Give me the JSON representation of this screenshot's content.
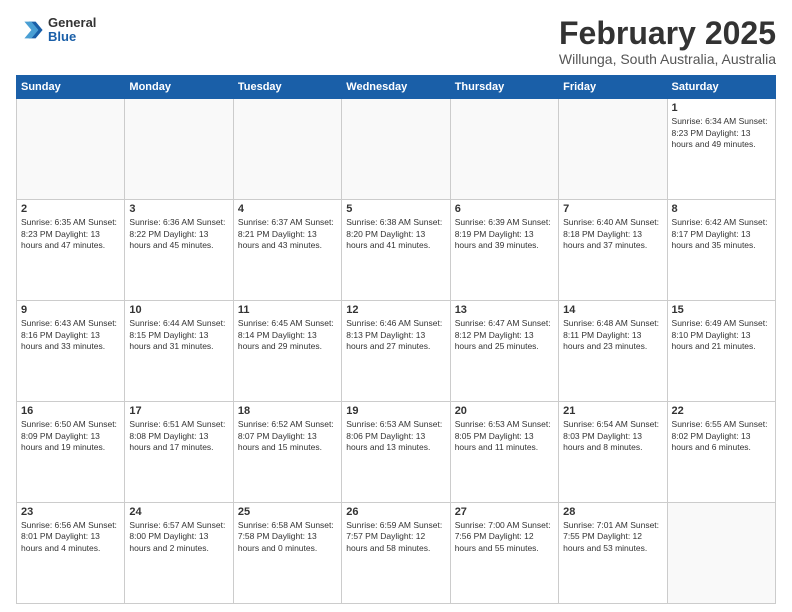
{
  "logo": {
    "general": "General",
    "blue": "Blue"
  },
  "header": {
    "title": "February 2025",
    "subtitle": "Willunga, South Australia, Australia"
  },
  "weekdays": [
    "Sunday",
    "Monday",
    "Tuesday",
    "Wednesday",
    "Thursday",
    "Friday",
    "Saturday"
  ],
  "weeks": [
    [
      {
        "day": "",
        "info": ""
      },
      {
        "day": "",
        "info": ""
      },
      {
        "day": "",
        "info": ""
      },
      {
        "day": "",
        "info": ""
      },
      {
        "day": "",
        "info": ""
      },
      {
        "day": "",
        "info": ""
      },
      {
        "day": "1",
        "info": "Sunrise: 6:34 AM\nSunset: 8:23 PM\nDaylight: 13 hours\nand 49 minutes."
      }
    ],
    [
      {
        "day": "2",
        "info": "Sunrise: 6:35 AM\nSunset: 8:23 PM\nDaylight: 13 hours\nand 47 minutes."
      },
      {
        "day": "3",
        "info": "Sunrise: 6:36 AM\nSunset: 8:22 PM\nDaylight: 13 hours\nand 45 minutes."
      },
      {
        "day": "4",
        "info": "Sunrise: 6:37 AM\nSunset: 8:21 PM\nDaylight: 13 hours\nand 43 minutes."
      },
      {
        "day": "5",
        "info": "Sunrise: 6:38 AM\nSunset: 8:20 PM\nDaylight: 13 hours\nand 41 minutes."
      },
      {
        "day": "6",
        "info": "Sunrise: 6:39 AM\nSunset: 8:19 PM\nDaylight: 13 hours\nand 39 minutes."
      },
      {
        "day": "7",
        "info": "Sunrise: 6:40 AM\nSunset: 8:18 PM\nDaylight: 13 hours\nand 37 minutes."
      },
      {
        "day": "8",
        "info": "Sunrise: 6:42 AM\nSunset: 8:17 PM\nDaylight: 13 hours\nand 35 minutes."
      }
    ],
    [
      {
        "day": "9",
        "info": "Sunrise: 6:43 AM\nSunset: 8:16 PM\nDaylight: 13 hours\nand 33 minutes."
      },
      {
        "day": "10",
        "info": "Sunrise: 6:44 AM\nSunset: 8:15 PM\nDaylight: 13 hours\nand 31 minutes."
      },
      {
        "day": "11",
        "info": "Sunrise: 6:45 AM\nSunset: 8:14 PM\nDaylight: 13 hours\nand 29 minutes."
      },
      {
        "day": "12",
        "info": "Sunrise: 6:46 AM\nSunset: 8:13 PM\nDaylight: 13 hours\nand 27 minutes."
      },
      {
        "day": "13",
        "info": "Sunrise: 6:47 AM\nSunset: 8:12 PM\nDaylight: 13 hours\nand 25 minutes."
      },
      {
        "day": "14",
        "info": "Sunrise: 6:48 AM\nSunset: 8:11 PM\nDaylight: 13 hours\nand 23 minutes."
      },
      {
        "day": "15",
        "info": "Sunrise: 6:49 AM\nSunset: 8:10 PM\nDaylight: 13 hours\nand 21 minutes."
      }
    ],
    [
      {
        "day": "16",
        "info": "Sunrise: 6:50 AM\nSunset: 8:09 PM\nDaylight: 13 hours\nand 19 minutes."
      },
      {
        "day": "17",
        "info": "Sunrise: 6:51 AM\nSunset: 8:08 PM\nDaylight: 13 hours\nand 17 minutes."
      },
      {
        "day": "18",
        "info": "Sunrise: 6:52 AM\nSunset: 8:07 PM\nDaylight: 13 hours\nand 15 minutes."
      },
      {
        "day": "19",
        "info": "Sunrise: 6:53 AM\nSunset: 8:06 PM\nDaylight: 13 hours\nand 13 minutes."
      },
      {
        "day": "20",
        "info": "Sunrise: 6:53 AM\nSunset: 8:05 PM\nDaylight: 13 hours\nand 11 minutes."
      },
      {
        "day": "21",
        "info": "Sunrise: 6:54 AM\nSunset: 8:03 PM\nDaylight: 13 hours\nand 8 minutes."
      },
      {
        "day": "22",
        "info": "Sunrise: 6:55 AM\nSunset: 8:02 PM\nDaylight: 13 hours\nand 6 minutes."
      }
    ],
    [
      {
        "day": "23",
        "info": "Sunrise: 6:56 AM\nSunset: 8:01 PM\nDaylight: 13 hours\nand 4 minutes."
      },
      {
        "day": "24",
        "info": "Sunrise: 6:57 AM\nSunset: 8:00 PM\nDaylight: 13 hours\nand 2 minutes."
      },
      {
        "day": "25",
        "info": "Sunrise: 6:58 AM\nSunset: 7:58 PM\nDaylight: 13 hours\nand 0 minutes."
      },
      {
        "day": "26",
        "info": "Sunrise: 6:59 AM\nSunset: 7:57 PM\nDaylight: 12 hours\nand 58 minutes."
      },
      {
        "day": "27",
        "info": "Sunrise: 7:00 AM\nSunset: 7:56 PM\nDaylight: 12 hours\nand 55 minutes."
      },
      {
        "day": "28",
        "info": "Sunrise: 7:01 AM\nSunset: 7:55 PM\nDaylight: 12 hours\nand 53 minutes."
      },
      {
        "day": "",
        "info": ""
      }
    ]
  ]
}
